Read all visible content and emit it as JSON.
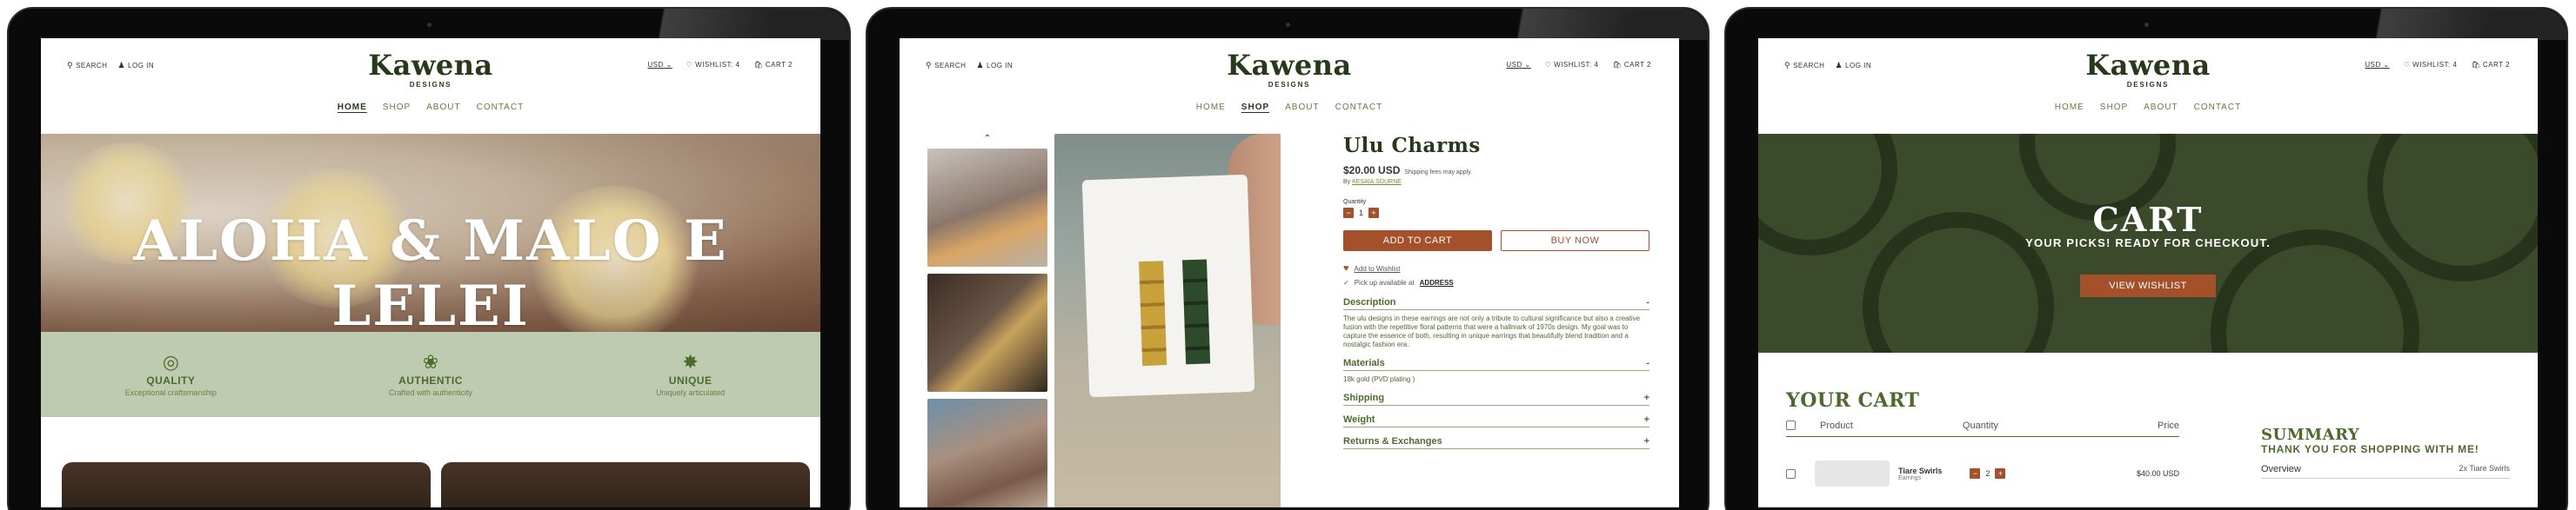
{
  "header": {
    "search_label": "SEARCH",
    "login_label": "LOG IN",
    "currency": "USD",
    "wishlist_label": "WISHLIST: 4",
    "cart_label": "CART 2",
    "logo": "Kawena",
    "logo_sub": "DESIGNS",
    "nav": [
      "HOME",
      "SHOP",
      "ABOUT",
      "CONTACT"
    ]
  },
  "home": {
    "hero_title": "ALOHA & MALO E LELEI",
    "features": [
      {
        "icon": "target-icon",
        "title": "QUALITY",
        "subtitle": "Exceptional craftsmanship"
      },
      {
        "icon": "hands-icon",
        "title": "AUTHENTIC",
        "subtitle": "Crafted with authenticity"
      },
      {
        "icon": "sun-icon",
        "title": "UNIQUE",
        "subtitle": "Uniquely articulated"
      }
    ]
  },
  "product": {
    "title": "Ulu Charms",
    "price": "$20.00 USD",
    "shipping_note": "Shipping fees may apply.",
    "by_prefix": "By",
    "by_name": "KESAIA SOURNE",
    "quantity_label": "Quantity",
    "quantity": "1",
    "add_to_cart": "ADD TO CART",
    "buy_now": "BUY NOW",
    "wishlist_link": "Add to Wishlist",
    "pickup_text": "Pick up available at",
    "pickup_link": "ADDRESS",
    "sections": [
      {
        "title": "Description",
        "toggle": "-",
        "body": "The ulu designs in these earrings are not only a tribute to cultural significance but also a creative fusion with the repetitive floral patterns that were a hallmark of 1970s design. My goal was to capture the essence of both, resulting in unique earrings that beautifully blend tradition and a nostalgic fashion era."
      },
      {
        "title": "Materials",
        "toggle": "-",
        "body": "18k gold (PVD plating )"
      },
      {
        "title": "Shipping",
        "toggle": "+",
        "body": ""
      },
      {
        "title": "Weight",
        "toggle": "+",
        "body": ""
      },
      {
        "title": "Returns & Exchanges",
        "toggle": "+",
        "body": ""
      }
    ]
  },
  "cart": {
    "hero_title": "CART",
    "hero_sub": "YOUR PICKS! READY FOR CHECKOUT.",
    "view_wishlist": "VIEW WISHLIST",
    "section_title": "YOUR CART",
    "columns": [
      "Product",
      "Quantity",
      "Price"
    ],
    "items": [
      {
        "name": "Tiare Swirls",
        "variant": "Earrings",
        "quantity": "2",
        "price": "$40.00 USD"
      }
    ],
    "summary_title": "SUMMARY",
    "summary_sub": "THANK YOU FOR SHOPPING WITH ME!",
    "overview_label": "Overview",
    "overview_value": "2x Tiare Swirls"
  }
}
